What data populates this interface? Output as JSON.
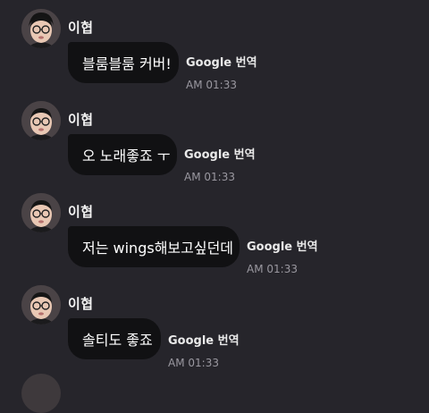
{
  "chat": {
    "messages": [
      {
        "sender": "이협",
        "text": "블룸블룸 커버!",
        "translate_label": "Google 번역",
        "time": "AM 01:33"
      },
      {
        "sender": "이협",
        "text": "오 노래좋죠 ㅜ",
        "translate_label": "Google 번역",
        "time": "AM 01:33"
      },
      {
        "sender": "이협",
        "text": "저는 wings해보고싶던데",
        "translate_label": "Google 번역",
        "time": "AM 01:33"
      },
      {
        "sender": "이협",
        "text": "솔티도 좋죠",
        "translate_label": "Google 번역",
        "time": "AM 01:33"
      }
    ]
  },
  "colors": {
    "background": "#26252b",
    "bubble": "#111113",
    "timestamp": "#9a98a0"
  }
}
